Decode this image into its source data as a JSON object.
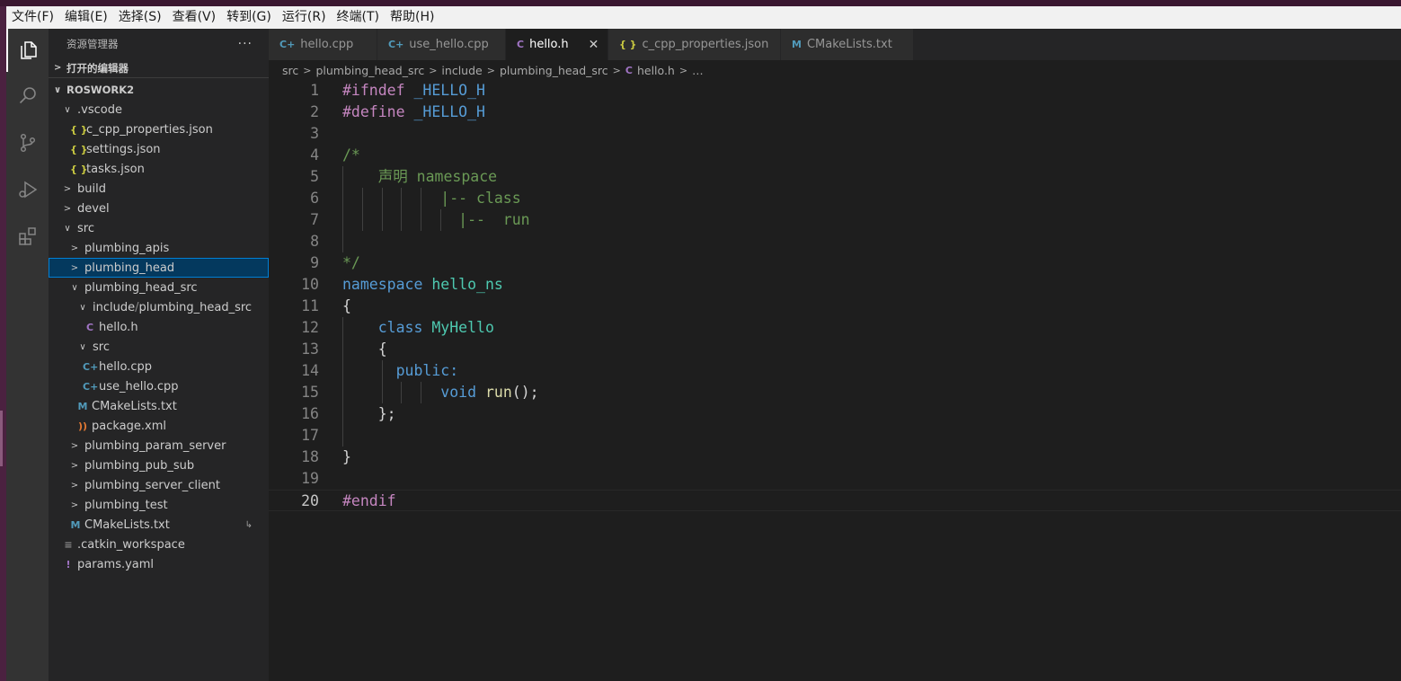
{
  "menubar": {
    "items": [
      "文件(F)",
      "编辑(E)",
      "选择(S)",
      "查看(V)",
      "转到(G)",
      "运行(R)",
      "终端(T)",
      "帮助(H)"
    ]
  },
  "sidebar": {
    "title": "资源管理器",
    "more": "···",
    "open_editors": "打开的编辑器",
    "workspace": "ROSWORK2",
    "tree": [
      {
        "label": ".vscode",
        "chev": "∨",
        "indent": 14
      },
      {
        "label": "c_cpp_properties.json",
        "icon": "{ }",
        "iconClass": "ic-json",
        "indent": 24
      },
      {
        "label": "settings.json",
        "icon": "{ }",
        "iconClass": "ic-json",
        "indent": 24
      },
      {
        "label": "tasks.json",
        "icon": "{ }",
        "iconClass": "ic-json",
        "indent": 24
      },
      {
        "label": "build",
        "chev": ">",
        "indent": 14
      },
      {
        "label": "devel",
        "chev": ">",
        "indent": 14
      },
      {
        "label": "src",
        "chev": "∨",
        "indent": 14
      },
      {
        "label": "plumbing_apis",
        "chev": ">",
        "indent": 22
      },
      {
        "label": "plumbing_head",
        "chev": ">",
        "indent": 22,
        "selected": true
      },
      {
        "label": "plumbing_head_src",
        "chev": "∨",
        "indent": 22
      },
      {
        "label": "include",
        "sep": " / ",
        "label2": "plumbing_head_src",
        "chev": "∨",
        "indent": 31
      },
      {
        "label": "hello.h",
        "icon": "C",
        "iconClass": "ic-c",
        "indent": 38
      },
      {
        "label": "src",
        "chev": "∨",
        "indent": 31
      },
      {
        "label": "hello.cpp",
        "icon": "C+",
        "iconClass": "ic-cpp",
        "indent": 38
      },
      {
        "label": "use_hello.cpp",
        "icon": "C+",
        "iconClass": "ic-cpp",
        "indent": 38
      },
      {
        "label": "CMakeLists.txt",
        "icon": "M",
        "iconClass": "ic-m",
        "indent": 30
      },
      {
        "label": "package.xml",
        "icon": "))",
        "iconClass": "ic-xml",
        "indent": 30
      },
      {
        "label": "plumbing_param_server",
        "chev": ">",
        "indent": 22
      },
      {
        "label": "plumbing_pub_sub",
        "chev": ">",
        "indent": 22
      },
      {
        "label": "plumbing_server_client",
        "chev": ">",
        "indent": 22
      },
      {
        "label": "plumbing_test",
        "chev": ">",
        "indent": 22
      },
      {
        "label": "CMakeLists.txt",
        "icon": "M",
        "iconClass": "ic-m",
        "indent": 22,
        "trail": "↳"
      },
      {
        "label": ".catkin_workspace",
        "icon": "≡",
        "iconClass": "ic-txt",
        "indent": 14
      },
      {
        "label": "params.yaml",
        "icon": "!",
        "iconClass": "ic-yaml",
        "indent": 14
      }
    ]
  },
  "tabs": [
    {
      "label": "hello.cpp",
      "icon": "C+",
      "iconClass": "ic-cpp",
      "width": 121
    },
    {
      "label": "use_hello.cpp",
      "icon": "C+",
      "iconClass": "ic-cpp",
      "width": 143
    },
    {
      "label": "hello.h",
      "icon": "C",
      "iconClass": "ic-c",
      "active": true,
      "close": "✕",
      "width": 114
    },
    {
      "label": "c_cpp_properties.json",
      "icon": "{ }",
      "iconClass": "ic-json",
      "width": 192
    },
    {
      "label": "CMakeLists.txt",
      "icon": "M",
      "iconClass": "ic-m",
      "width": 148
    }
  ],
  "breadcrumb": {
    "parts": [
      "src",
      "plumbing_head_src",
      "include",
      "plumbing_head_src"
    ],
    "file_icon": "C",
    "file": "hello.h",
    "ellipsis": "…"
  },
  "editor": {
    "lines": [
      {
        "n": "1",
        "tokens": [
          [
            "#ifndef",
            "k-pre"
          ],
          [
            " ",
            ""
          ],
          [
            "_HELLO_H",
            "k-mac"
          ]
        ]
      },
      {
        "n": "2",
        "tokens": [
          [
            "#define",
            "k-pre"
          ],
          [
            " ",
            ""
          ],
          [
            "_HELLO_H",
            "k-mac"
          ]
        ]
      },
      {
        "n": "3",
        "tokens": []
      },
      {
        "n": "4",
        "tokens": [
          [
            "/*",
            "k-com"
          ]
        ]
      },
      {
        "n": "5",
        "tokens": [
          [
            "    声明 namespace",
            "k-com"
          ]
        ],
        "guides": [
          0
        ]
      },
      {
        "n": "6",
        "tokens": [
          [
            "           |-- class",
            "k-com"
          ]
        ],
        "guides": [
          0,
          1,
          2,
          3,
          4
        ]
      },
      {
        "n": "7",
        "tokens": [
          [
            "             |--  run",
            "k-com"
          ]
        ],
        "guides": [
          0,
          1,
          2,
          3,
          4,
          5
        ]
      },
      {
        "n": "8",
        "tokens": [],
        "guides": [
          0
        ]
      },
      {
        "n": "9",
        "tokens": [
          [
            "*/",
            "k-com"
          ]
        ]
      },
      {
        "n": "10",
        "tokens": [
          [
            "namespace",
            "k-kw"
          ],
          [
            " ",
            ""
          ],
          [
            "hello_ns",
            "k-typ"
          ]
        ]
      },
      {
        "n": "11",
        "tokens": [
          [
            "{",
            "k-pun"
          ]
        ]
      },
      {
        "n": "12",
        "tokens": [
          [
            "    ",
            ""
          ],
          [
            "class",
            "k-kw"
          ],
          [
            " ",
            ""
          ],
          [
            "MyHello",
            "k-typ"
          ]
        ],
        "guides": [
          0
        ]
      },
      {
        "n": "13",
        "tokens": [
          [
            "    {",
            "k-pun"
          ]
        ],
        "guides": [
          0
        ]
      },
      {
        "n": "14",
        "tokens": [
          [
            "      ",
            ""
          ],
          [
            "public:",
            "k-kw"
          ]
        ],
        "guides": [
          0,
          2
        ]
      },
      {
        "n": "15",
        "tokens": [
          [
            "           ",
            ""
          ],
          [
            "void",
            "k-kw"
          ],
          [
            " ",
            ""
          ],
          [
            "run",
            "k-fn"
          ],
          [
            "();",
            "k-pun"
          ]
        ],
        "guides": [
          0,
          2,
          3,
          4
        ]
      },
      {
        "n": "16",
        "tokens": [
          [
            "    };",
            "k-pun"
          ]
        ],
        "guides": [
          0
        ]
      },
      {
        "n": "17",
        "tokens": [],
        "guides": [
          0
        ]
      },
      {
        "n": "18",
        "tokens": [
          [
            "}",
            "k-pun"
          ]
        ]
      },
      {
        "n": "19",
        "tokens": []
      },
      {
        "n": "20",
        "tokens": [
          [
            "#endif",
            "k-pre"
          ]
        ],
        "current": true
      }
    ]
  }
}
